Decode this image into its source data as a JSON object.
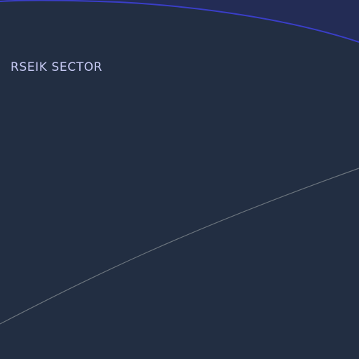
{
  "map": {
    "sector_label": "RSEIK SECTOR",
    "colors": {
      "background": "#222e42",
      "region_fill": "#232c55",
      "region_border": "#3a3ec8",
      "route_line": "#6b747d",
      "label": "#c7caf4"
    }
  }
}
